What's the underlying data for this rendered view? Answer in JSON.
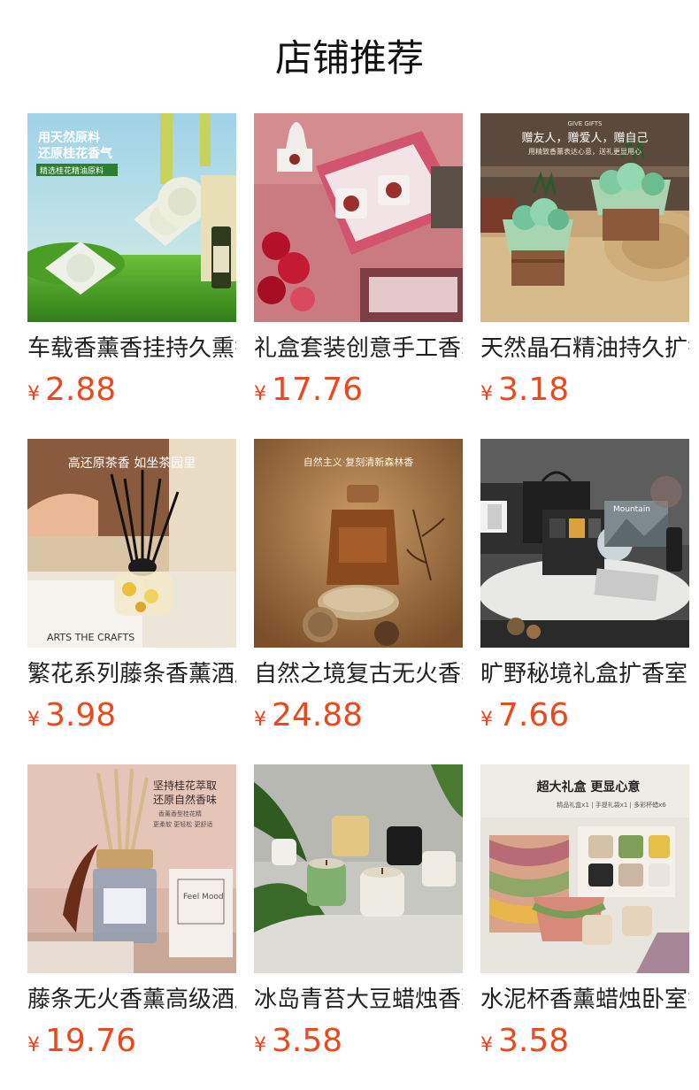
{
  "page": {
    "title": "店铺推荐",
    "currency": "¥"
  },
  "products": [
    {
      "name": "车载香薰香挂持久熏香",
      "price": "2.88",
      "image_text": [
        "用天然原料",
        "还原桂花香气",
        "精选桂花精油原料"
      ]
    },
    {
      "name": "礼盒套装创意手工香薰",
      "price": "17.76",
      "image_text": []
    },
    {
      "name": "天然晶石精油持久扩香",
      "price": "3.18",
      "image_text": [
        "GIVE GIFTS",
        "赠友人，赠爱人，赠自己",
        "用精致香薰表达心意，送礼更显用心"
      ]
    },
    {
      "name": "繁花系列藤条香薰酒店",
      "price": "3.98",
      "image_text": [
        "高还原茶香  如坐茶园里",
        "ARTS THE CRAFTS"
      ]
    },
    {
      "name": "自然之境复古无火香薰",
      "price": "24.88",
      "image_text": [
        "自然主义·复刻清新森林香"
      ]
    },
    {
      "name": "旷野秘境礼盒扩香室内",
      "price": "7.66",
      "image_text": [
        "Mountain"
      ]
    },
    {
      "name": "藤条无火香薰高级酒店",
      "price": "19.76",
      "image_text": [
        "坚持桂花萃取",
        "还原自然香味",
        "香薰香型桂花精",
        "更柔软 更轻松 更舒适",
        "Feel Mood"
      ]
    },
    {
      "name": "冰岛青苔大豆蜡烛香薰",
      "price": "3.58",
      "image_text": []
    },
    {
      "name": "水泥杯香薰蜡烛卧室香",
      "price": "3.58",
      "image_text": [
        "超大礼盒 更显心意",
        "精品礼盒x1 | 手提礼袋x1 | 多彩杯蜡x6"
      ]
    }
  ]
}
